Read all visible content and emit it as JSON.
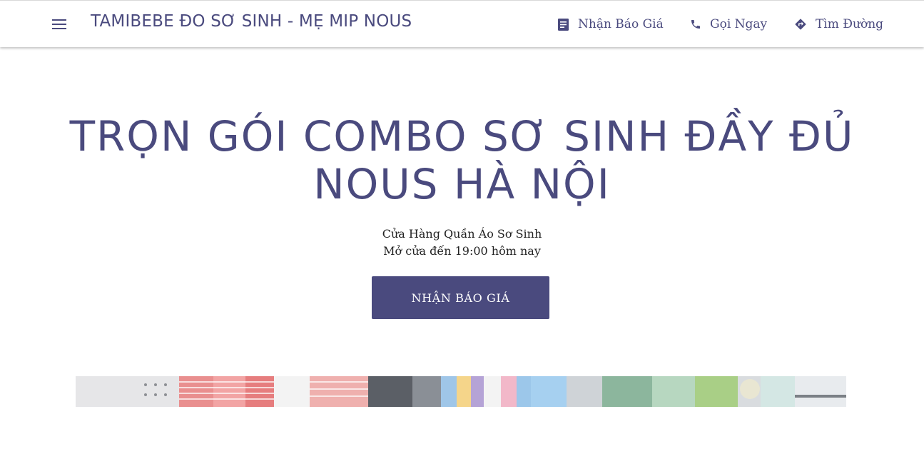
{
  "colors": {
    "accent": "#4a4a7e"
  },
  "header": {
    "site_title": "TAMIBEBE ĐO SƠ SINH - MẸ MIP NOUS",
    "menu_icon": "menu-icon",
    "actions": [
      {
        "label": "Nhận Báo Giá",
        "icon": "quote-icon"
      },
      {
        "label": "Gọi Ngay",
        "icon": "phone-icon"
      },
      {
        "label": "Tìm Đường",
        "icon": "directions-icon"
      }
    ]
  },
  "hero": {
    "title_line1": "TRỌN GÓI COMBO SƠ SINH ĐẦY ĐỦ",
    "title_line2": "NOUS HÀ NỘI",
    "category": "Cửa Hàng Quần Áo Sơ Sinh",
    "hours": "Mở cửa đến 19:00 hôm nay",
    "cta_label": "NHẬN BÁO GIÁ"
  }
}
